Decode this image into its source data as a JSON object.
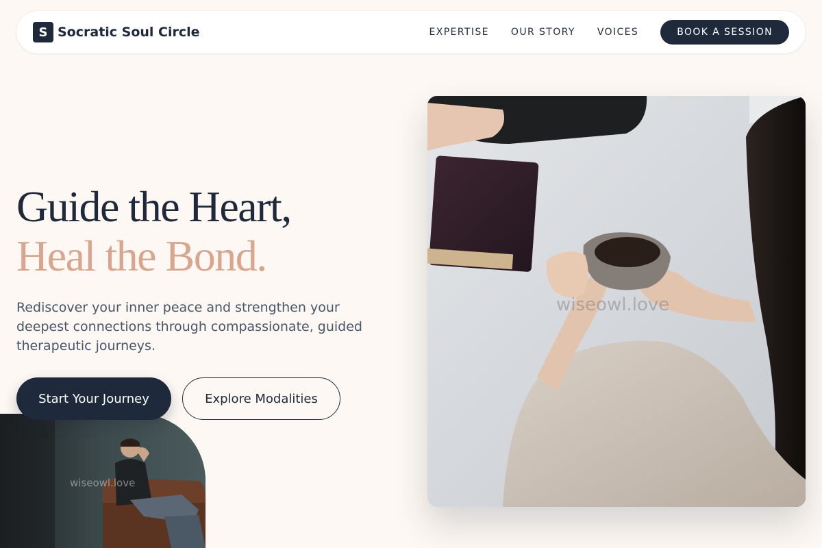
{
  "brand": {
    "mark": "S",
    "name": "Socratic Soul Circle"
  },
  "nav": {
    "links": [
      "EXPERTISE",
      "OUR STORY",
      "VOICES"
    ],
    "cta": "BOOK A SESSION"
  },
  "hero": {
    "headline_line1": "Guide the Heart,",
    "headline_line2": "Heal the Bond.",
    "lede": "Rediscover your inner peace and strengthen your deepest connections through compassionate, guided therapeutic journeys.",
    "primary_cta": "Start Your Journey",
    "secondary_cta": "Explore Modalities"
  },
  "images": {
    "main_watermark": "wiseowl.love",
    "side_watermark": "wiseowl.love"
  },
  "colors": {
    "navy": "#1e293b",
    "accent": "#d9a68d",
    "background": "#fdf8f3"
  }
}
